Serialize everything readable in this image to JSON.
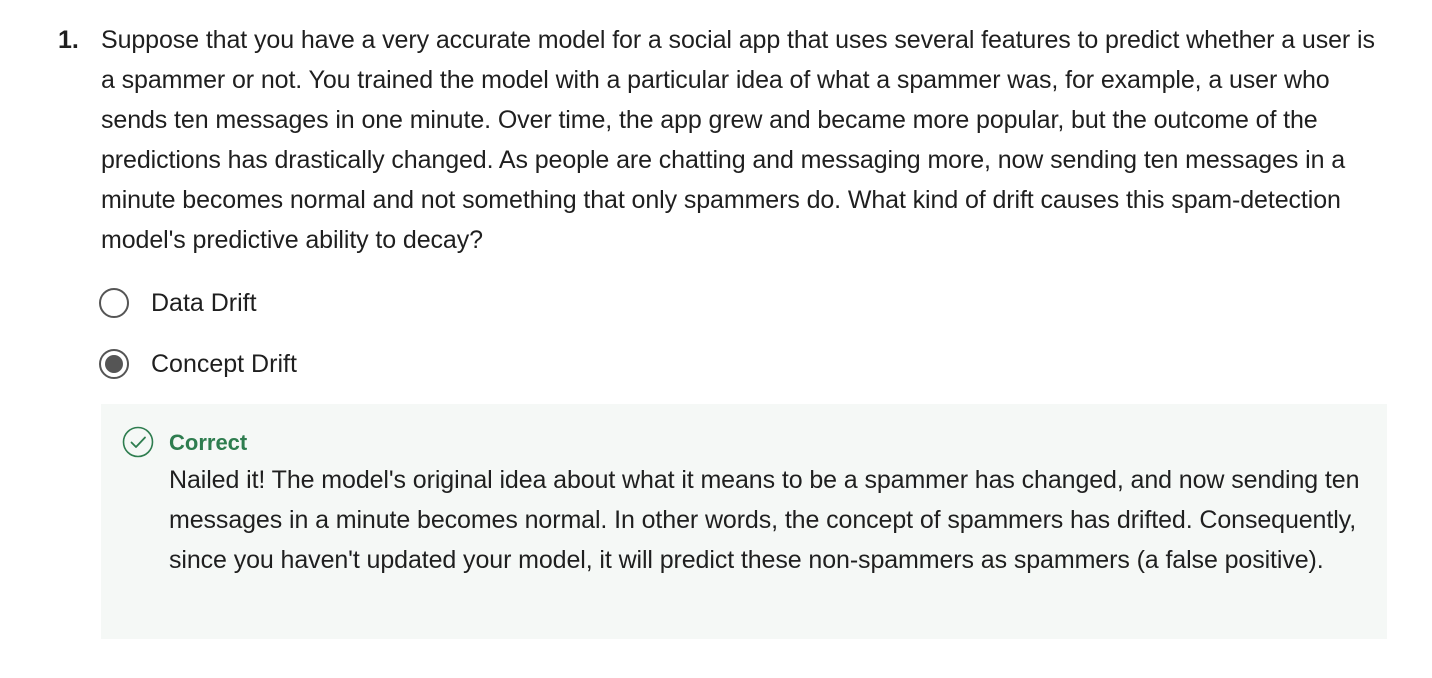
{
  "question": {
    "number": "1.",
    "text": "Suppose that you have a very accurate model for a social app that uses several features to predict whether a user is a spammer or not. You trained the model with a particular idea of what a spammer was, for example, a user who sends ten messages in one minute. Over time, the app grew and became more popular, but the outcome of the predictions has drastically changed. As people are chatting and messaging more, now sending ten messages in a minute becomes normal and not something that only spammers do. What kind of drift causes this spam-detection model's predictive ability to decay?"
  },
  "options": [
    {
      "label": "Data Drift",
      "selected": false
    },
    {
      "label": "Concept Drift",
      "selected": true
    }
  ],
  "feedback": {
    "icon": "check-circle-icon",
    "status": "Correct",
    "text": "Nailed it! The model's original idea about what it means to be a spammer has changed, and now sending ten messages in a minute becomes normal. In other words, the concept of spammers has drifted. Consequently, since you haven't updated your model, it will predict these non-spammers as spammers (a false positive).",
    "color": "#2e7d4f",
    "background": "#f5f8f6"
  }
}
